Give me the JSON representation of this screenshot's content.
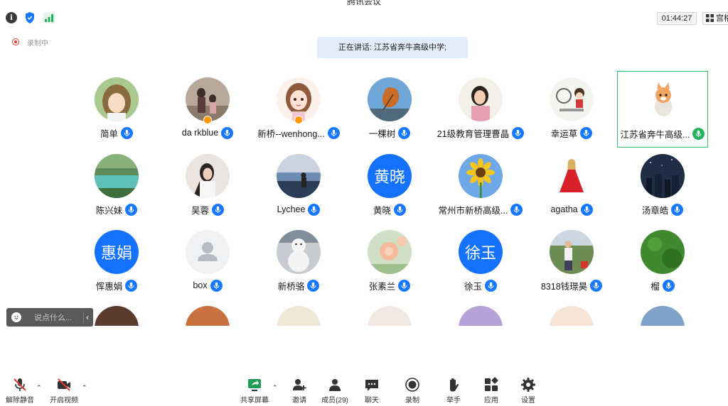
{
  "window": {
    "title": "腾讯会议"
  },
  "topbar": {
    "timer": "01:44:27",
    "view_label": "宫格"
  },
  "recording": {
    "label": "录制中"
  },
  "speaking": {
    "text": "正在讲话: 江苏省奔牛高级中学;"
  },
  "participants": [
    {
      "name": "简单",
      "avatar_text": "",
      "avatar": "anime-girl"
    },
    {
      "name": "da rkblue",
      "avatar_text": "",
      "avatar": "family-photo"
    },
    {
      "name": "新桥--wenhong...",
      "avatar_text": "",
      "avatar": "cartoon-girl"
    },
    {
      "name": "一棵树",
      "avatar_text": "",
      "avatar": "leaf-sky"
    },
    {
      "name": "21级教育管理曹晶",
      "avatar_text": "",
      "avatar": "woman-photo"
    },
    {
      "name": "幸运草",
      "avatar_text": "",
      "avatar": "cartoon-boy"
    },
    {
      "name": "江苏省奔牛高级...",
      "avatar_text": "",
      "avatar": "cat-cartoon"
    },
    {
      "name": "陈兴妹",
      "avatar_text": "",
      "avatar": "lake-landscape"
    },
    {
      "name": "吴蓉",
      "avatar_text": "",
      "avatar": "girl-photo"
    },
    {
      "name": "Lychee",
      "avatar_text": "",
      "avatar": "sunset-person"
    },
    {
      "name": "黄晓",
      "avatar_text": "黄晓",
      "avatar": "text"
    },
    {
      "name": "常州市新桥高级...",
      "avatar_text": "",
      "avatar": "sunflower"
    },
    {
      "name": "agatha",
      "avatar_text": "",
      "avatar": "red-dress"
    },
    {
      "name": "汤章皓",
      "avatar_text": "",
      "avatar": "night-city"
    },
    {
      "name": "恽惠娟",
      "avatar_text": "惠娟",
      "avatar": "text"
    },
    {
      "name": "box",
      "avatar_text": "",
      "avatar": "default-user"
    },
    {
      "name": "新桥骆",
      "avatar_text": "",
      "avatar": "snowman"
    },
    {
      "name": "张素兰",
      "avatar_text": "",
      "avatar": "flower"
    },
    {
      "name": "徐玉",
      "avatar_text": "徐玉",
      "avatar": "text"
    },
    {
      "name": "8318钱璟昊",
      "avatar_text": "",
      "avatar": "man-garden"
    },
    {
      "name": "榴",
      "avatar_text": "",
      "avatar": "green-grass"
    }
  ],
  "chat": {
    "placeholder": "说点什么..."
  },
  "toolbar": {
    "unmute": "解除静音",
    "start_video": "开启视频",
    "share_screen": "共享屏幕",
    "invite": "邀请",
    "members": "成员(29)",
    "chat": "聊天",
    "record": "录制",
    "raise_hand": "举手",
    "apps": "应用",
    "settings": "设置"
  },
  "colors": {
    "accent": "#1677ff",
    "active_speaker": "#33c26a",
    "speaking_bg": "#e2edfb",
    "record_red": "#e53935"
  }
}
